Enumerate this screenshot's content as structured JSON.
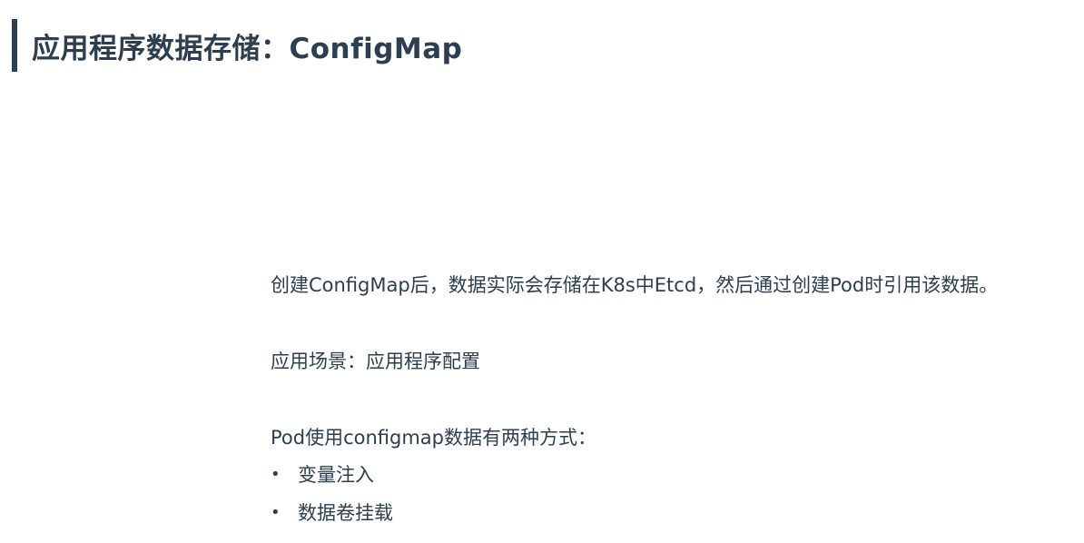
{
  "title": "应用程序数据存储：ConfigMap",
  "paragraphs": {
    "intro": "创建ConfigMap后，数据实际会存储在K8s中Etcd，然后通过创建Pod时引用该数据。",
    "scenario": "应用场景：应用程序配置",
    "methods_heading": "Pod使用configmap数据有两种方式："
  },
  "bullets": [
    {
      "marker": "•",
      "text": "变量注入"
    },
    {
      "marker": "•",
      "text": "数据卷挂载"
    }
  ]
}
